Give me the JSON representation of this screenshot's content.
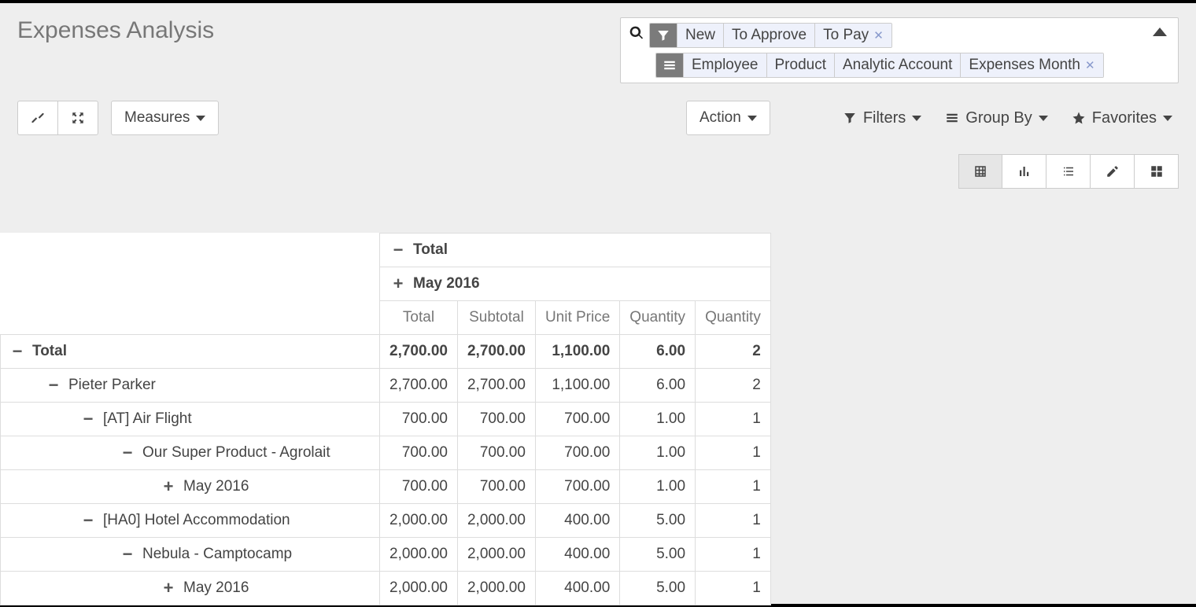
{
  "header": {
    "title": "Expenses Analysis",
    "measures_label": "Measures",
    "action_label": "Action"
  },
  "search": {
    "filter_facets": [
      "New",
      "To Approve",
      "To Pay"
    ],
    "group_facets": [
      "Employee",
      "Product",
      "Analytic Account",
      "Expenses Month"
    ]
  },
  "toolbar": {
    "filters": "Filters",
    "group_by": "Group By",
    "favorites": "Favorites"
  },
  "pivot": {
    "col_total": "Total",
    "col_group": "May 2016",
    "col_headers": [
      "Total",
      "Subtotal",
      "Unit Price",
      "Quantity",
      "Quantity"
    ],
    "rows": [
      {
        "label": "Total",
        "indent": 0,
        "toggle": "−",
        "bold": true,
        "vals": [
          "2,700.00",
          "2,700.00",
          "1,100.00",
          "6.00",
          "2"
        ]
      },
      {
        "label": "Pieter Parker",
        "indent": 1,
        "toggle": "−",
        "bold": false,
        "vals": [
          "2,700.00",
          "2,700.00",
          "1,100.00",
          "6.00",
          "2"
        ]
      },
      {
        "label": "[AT] Air Flight",
        "indent": 2,
        "toggle": "−",
        "bold": false,
        "vals": [
          "700.00",
          "700.00",
          "700.00",
          "1.00",
          "1"
        ]
      },
      {
        "label": "Our Super Product - Agrolait",
        "indent": 3,
        "toggle": "−",
        "bold": false,
        "vals": [
          "700.00",
          "700.00",
          "700.00",
          "1.00",
          "1"
        ]
      },
      {
        "label": "May 2016",
        "indent": 4,
        "toggle": "+",
        "bold": false,
        "vals": [
          "700.00",
          "700.00",
          "700.00",
          "1.00",
          "1"
        ]
      },
      {
        "label": "[HA0] Hotel Accommodation",
        "indent": 2,
        "toggle": "−",
        "bold": false,
        "vals": [
          "2,000.00",
          "2,000.00",
          "400.00",
          "5.00",
          "1"
        ]
      },
      {
        "label": "Nebula - Camptocamp",
        "indent": 3,
        "toggle": "−",
        "bold": false,
        "vals": [
          "2,000.00",
          "2,000.00",
          "400.00",
          "5.00",
          "1"
        ]
      },
      {
        "label": "May 2016",
        "indent": 4,
        "toggle": "+",
        "bold": false,
        "vals": [
          "2,000.00",
          "2,000.00",
          "400.00",
          "5.00",
          "1"
        ]
      }
    ]
  }
}
